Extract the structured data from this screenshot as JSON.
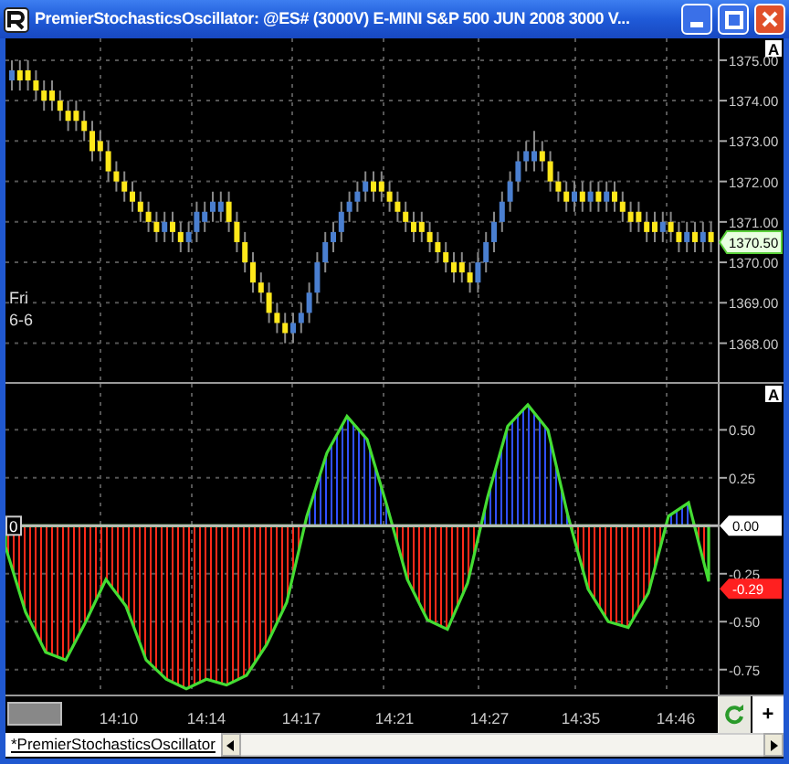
{
  "window": {
    "title": "PremierStochasticsOscillator: @ES# (3000V) E-MINI S&P 500 JUN 2008 3000 V..."
  },
  "price_panel": {
    "scale_button": "A",
    "last_price": "1370.50",
    "date_label": [
      "Fri",
      "6-6"
    ],
    "chart_data": {
      "type": "candlestick",
      "grid": true,
      "ylim": [
        1367.04,
        1375.54
      ],
      "yticks": [
        {
          "value": 1375,
          "label": "1375.00"
        },
        {
          "value": 1374,
          "label": "1374.00"
        },
        {
          "value": 1373,
          "label": "1373.00"
        },
        {
          "value": 1372,
          "label": "1372.00"
        },
        {
          "value": 1371,
          "label": "1371.00"
        },
        {
          "value": 1370,
          "label": "1370.00"
        },
        {
          "value": 1369,
          "label": "1369.00"
        },
        {
          "value": 1368,
          "label": "1368.00"
        }
      ],
      "categories": [
        null,
        null,
        null,
        null,
        null,
        null,
        null,
        null,
        null,
        null,
        null,
        null,
        null,
        null,
        null,
        null,
        null,
        null,
        null,
        null,
        null,
        null,
        null,
        null,
        null,
        null,
        null,
        null,
        null,
        null,
        null,
        null,
        null,
        null,
        null,
        null,
        null,
        null,
        null,
        null,
        null,
        null,
        null,
        null,
        null,
        null,
        null,
        null,
        null,
        null,
        null,
        null,
        null,
        null,
        null,
        null,
        null,
        null,
        null,
        null,
        null,
        null,
        null,
        null,
        null,
        null,
        null,
        null,
        null,
        null,
        null,
        null,
        null,
        null,
        null,
        null,
        null,
        null,
        null,
        null,
        null,
        null,
        null,
        null,
        null,
        null,
        null,
        null
      ],
      "ohlc": [
        [
          1374.5,
          1375,
          1374.25,
          1374.75
        ],
        [
          1374.75,
          1375,
          1374.25,
          1374.5
        ],
        [
          1374.75,
          1375,
          1374.25,
          1374.5
        ],
        [
          1374.5,
          1374.75,
          1374,
          1374.25
        ],
        [
          1374.25,
          1374.5,
          1373.75,
          1374
        ],
        [
          1374.25,
          1374.5,
          1373.75,
          1374
        ],
        [
          1374,
          1374.25,
          1373.5,
          1373.75
        ],
        [
          1373.75,
          1374,
          1373.25,
          1373.5
        ],
        [
          1373.75,
          1374,
          1373.25,
          1373.5
        ],
        [
          1373.5,
          1373.75,
          1373,
          1373.25
        ],
        [
          1373.25,
          1373.5,
          1372.5,
          1372.75
        ],
        [
          1373,
          1373.25,
          1372.5,
          1372.75
        ],
        [
          1372.75,
          1373,
          1372,
          1372.25
        ],
        [
          1372.25,
          1372.5,
          1371.75,
          1372
        ],
        [
          1372,
          1372.25,
          1371.5,
          1371.75
        ],
        [
          1371.75,
          1372,
          1371.25,
          1371.5
        ],
        [
          1371.5,
          1371.75,
          1371,
          1371.25
        ],
        [
          1371.25,
          1371.5,
          1370.75,
          1371
        ],
        [
          1371,
          1371.25,
          1370.5,
          1370.75
        ],
        [
          1370.75,
          1371.25,
          1370.5,
          1371
        ],
        [
          1371,
          1371.25,
          1370.5,
          1370.75
        ],
        [
          1370.75,
          1371,
          1370.25,
          1370.5
        ],
        [
          1370.5,
          1371,
          1370.25,
          1370.75
        ],
        [
          1370.75,
          1371.5,
          1370.5,
          1371.25
        ],
        [
          1371,
          1371.5,
          1370.75,
          1371.25
        ],
        [
          1371.25,
          1371.75,
          1371,
          1371.5
        ],
        [
          1371.25,
          1371.75,
          1371,
          1371.5
        ],
        [
          1371.5,
          1371.75,
          1370.75,
          1371
        ],
        [
          1371,
          1371.25,
          1370.25,
          1370.5
        ],
        [
          1370.5,
          1370.75,
          1369.75,
          1370
        ],
        [
          1370,
          1370.25,
          1369.25,
          1369.5
        ],
        [
          1369.5,
          1369.75,
          1369,
          1369.25
        ],
        [
          1369.25,
          1369.5,
          1368.5,
          1368.75
        ],
        [
          1368.75,
          1369,
          1368.25,
          1368.5
        ],
        [
          1368.5,
          1368.75,
          1368,
          1368.25
        ],
        [
          1368.25,
          1368.75,
          1368,
          1368.5
        ],
        [
          1368.5,
          1369,
          1368.25,
          1368.75
        ],
        [
          1368.75,
          1369.5,
          1368.5,
          1369.25
        ],
        [
          1369.25,
          1370.25,
          1369,
          1370
        ],
        [
          1370,
          1370.75,
          1369.75,
          1370.5
        ],
        [
          1370.5,
          1371,
          1370.25,
          1370.75
        ],
        [
          1370.75,
          1371.5,
          1370.5,
          1371.25
        ],
        [
          1371.25,
          1371.75,
          1371,
          1371.5
        ],
        [
          1371.5,
          1372,
          1371.25,
          1371.75
        ],
        [
          1371.75,
          1372.25,
          1371.5,
          1372
        ],
        [
          1372,
          1372.25,
          1371.5,
          1371.75
        ],
        [
          1372,
          1372.25,
          1371.5,
          1371.75
        ],
        [
          1371.75,
          1372,
          1371.25,
          1371.5
        ],
        [
          1371.5,
          1371.75,
          1371,
          1371.25
        ],
        [
          1371.25,
          1371.5,
          1370.75,
          1371
        ],
        [
          1371,
          1371.25,
          1370.5,
          1370.75
        ],
        [
          1371,
          1371.25,
          1370.5,
          1370.75
        ],
        [
          1370.75,
          1371,
          1370.25,
          1370.5
        ],
        [
          1370.5,
          1370.75,
          1370,
          1370.25
        ],
        [
          1370.25,
          1370.5,
          1369.75,
          1370
        ],
        [
          1370,
          1370.25,
          1369.5,
          1369.75
        ],
        [
          1370,
          1370.25,
          1369.5,
          1369.75
        ],
        [
          1369.75,
          1370,
          1369.25,
          1369.5
        ],
        [
          1369.5,
          1370.25,
          1369.25,
          1370
        ],
        [
          1370,
          1370.75,
          1369.75,
          1370.5
        ],
        [
          1370.5,
          1371.25,
          1370.25,
          1371
        ],
        [
          1371,
          1371.75,
          1370.75,
          1371.5
        ],
        [
          1371.5,
          1372.25,
          1371.25,
          1372
        ],
        [
          1372,
          1372.75,
          1371.75,
          1372.5
        ],
        [
          1372.5,
          1373,
          1372.25,
          1372.75
        ],
        [
          1372.5,
          1373.25,
          1372.25,
          1372.75
        ],
        [
          1372.75,
          1373,
          1372.25,
          1372.5
        ],
        [
          1372.5,
          1372.75,
          1371.75,
          1372
        ],
        [
          1372,
          1372.25,
          1371.5,
          1371.75
        ],
        [
          1371.75,
          1372,
          1371.25,
          1371.5
        ],
        [
          1371.5,
          1372,
          1371.25,
          1371.75
        ],
        [
          1371.75,
          1372,
          1371.25,
          1371.5
        ],
        [
          1371.5,
          1372,
          1371.25,
          1371.75
        ],
        [
          1371.75,
          1372,
          1371.25,
          1371.5
        ],
        [
          1371.5,
          1372,
          1371.25,
          1371.75
        ],
        [
          1371.75,
          1372,
          1371.25,
          1371.5
        ],
        [
          1371.5,
          1371.75,
          1371,
          1371.25
        ],
        [
          1371.25,
          1371.5,
          1370.75,
          1371
        ],
        [
          1371.25,
          1371.5,
          1370.75,
          1371
        ],
        [
          1371,
          1371.25,
          1370.5,
          1370.75
        ],
        [
          1371,
          1371.25,
          1370.5,
          1370.75
        ],
        [
          1370.75,
          1371.25,
          1370.5,
          1371
        ],
        [
          1371,
          1371.25,
          1370.5,
          1370.75
        ],
        [
          1370.75,
          1371,
          1370.25,
          1370.5
        ],
        [
          1370.5,
          1371,
          1370.25,
          1370.75
        ],
        [
          1370.75,
          1371,
          1370.25,
          1370.5
        ],
        [
          1370.5,
          1371,
          1370.25,
          1370.75
        ],
        [
          1370.75,
          1371,
          1370.25,
          1370.5
        ]
      ]
    }
  },
  "oscillator_panel": {
    "scale_button": "A",
    "zero_marker": "0",
    "zero_tag": "0.00",
    "last_value": "-0.29",
    "chart_data": {
      "type": "area",
      "grid": true,
      "ylim": [
        -0.88,
        0.74
      ],
      "yticks": [
        {
          "value": 0.5,
          "label": "0.50"
        },
        {
          "value": 0.25,
          "label": "0.25"
        },
        {
          "value": -0.25,
          "label": "-0.25"
        },
        {
          "value": -0.5,
          "label": "-0.50"
        },
        {
          "value": -0.75,
          "label": "-0.75"
        }
      ],
      "categories": [
        null,
        null,
        null,
        null,
        null,
        null,
        null,
        null,
        null,
        null,
        null,
        null,
        null,
        null,
        null,
        null,
        null,
        null,
        null,
        null,
        null,
        null,
        null,
        null,
        null,
        null,
        null,
        null,
        null,
        null,
        null,
        null,
        null,
        null,
        null,
        null
      ],
      "series": [
        {
          "color": "#44dd33",
          "values": [
            -0.11,
            -0.45,
            -0.66,
            -0.7,
            -0.5,
            -0.28,
            -0.42,
            -0.7,
            -0.8,
            -0.85,
            -0.8,
            -0.83,
            -0.78,
            -0.62,
            -0.4,
            0.05,
            0.38,
            0.57,
            0.45,
            0.1,
            -0.28,
            -0.49,
            -0.54,
            -0.3,
            0.15,
            0.52,
            0.63,
            0.5,
            0.05,
            -0.33,
            -0.5,
            -0.53,
            -0.35,
            0.05,
            0.12,
            -0.29
          ]
        }
      ]
    }
  },
  "time_axis": {
    "labels": [
      "14:10",
      "14:14",
      "14:17",
      "14:21",
      "14:27",
      "14:35",
      "14:46"
    ]
  },
  "tabs": [
    {
      "label": "*PremierStochasticsOscillator",
      "selected": true
    }
  ],
  "add_button": "+"
}
